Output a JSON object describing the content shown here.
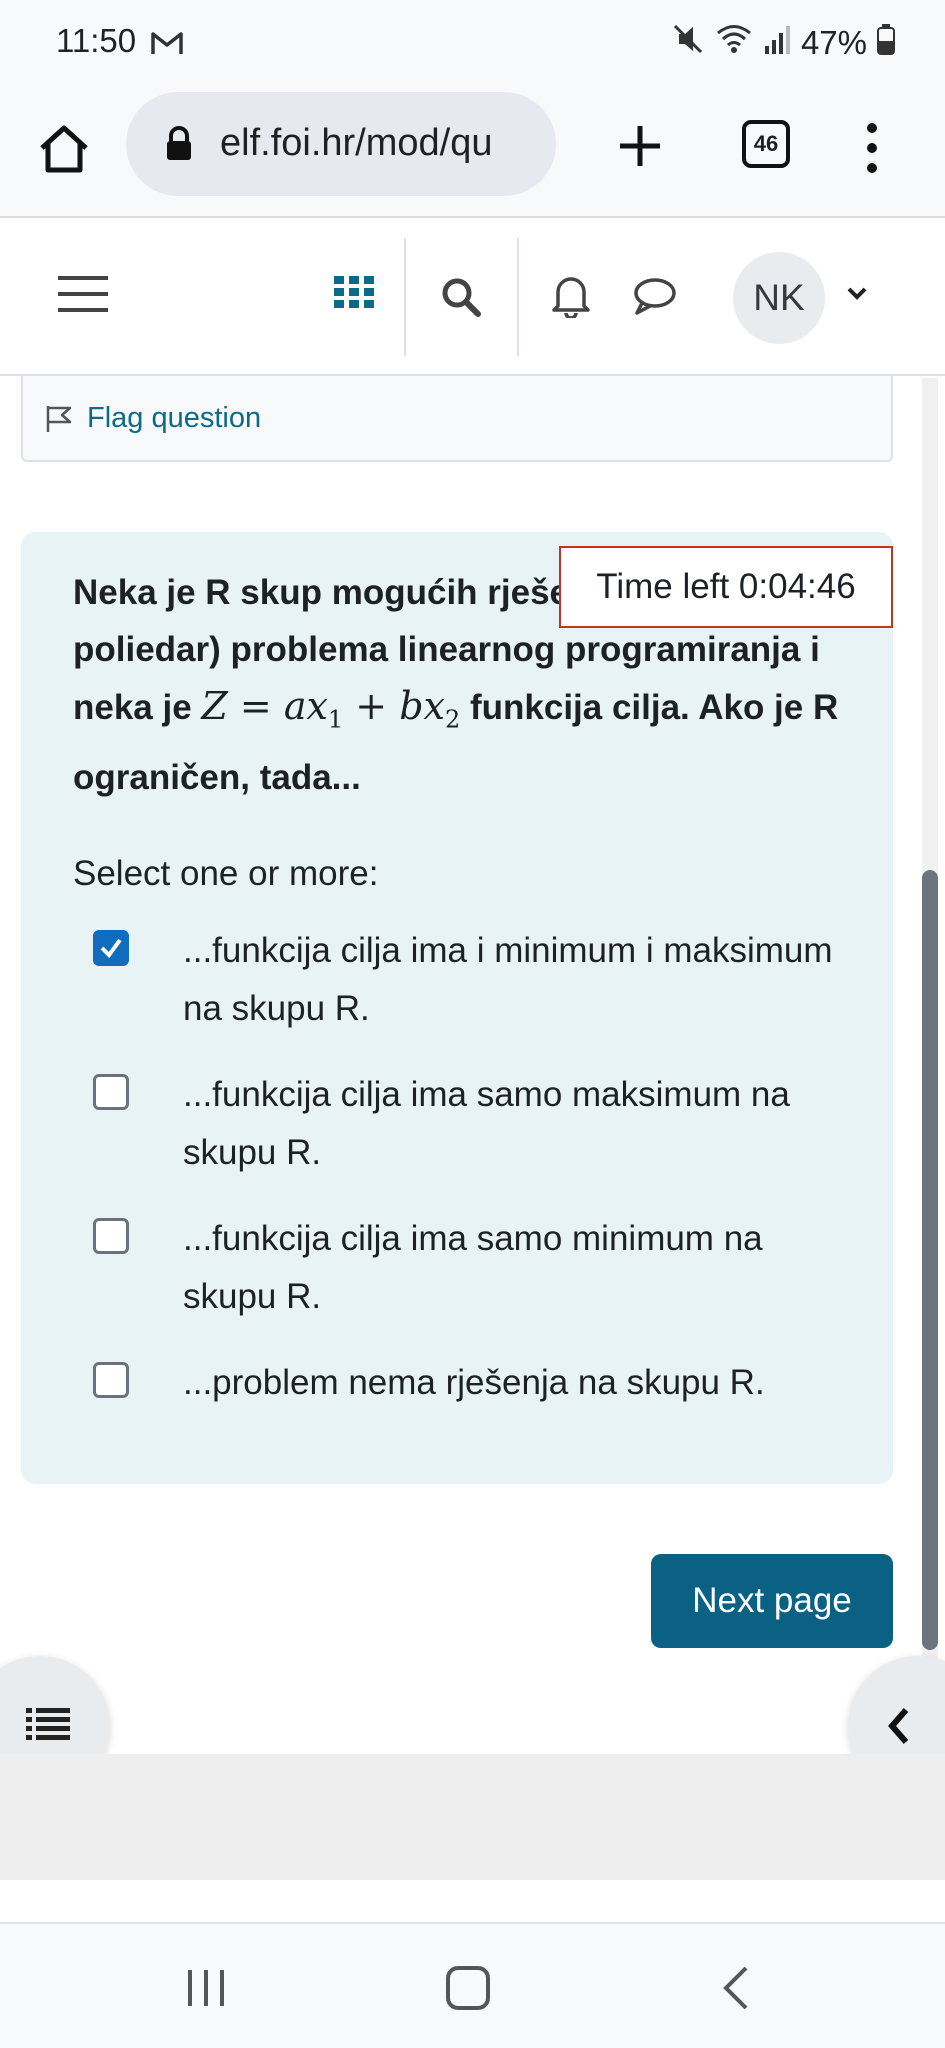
{
  "status_bar": {
    "time": "11:50",
    "battery": "47%"
  },
  "browser": {
    "url": "elf.foi.hr/mod/qu",
    "tab_count": "46"
  },
  "navbar": {
    "avatar_initials": "NK"
  },
  "quiz": {
    "flag_label": "Flag question",
    "timer": "Time left 0:04:46",
    "question_part1": "Neka je R skup mogućih rješenja (konveksni poliedar) problema linearnog programiranja i neka je ",
    "question_math": "Z = ax",
    "question_part2": " funkcija cilja. Ako je R ograničen, tada...",
    "select_label": "Select one or more:",
    "options": [
      {
        "label": "...funkcija cilja ima i minimum i maksimum na skupu R.",
        "checked": true
      },
      {
        "label": "...funkcija cilja ima samo maksimum na skupu R.",
        "checked": false
      },
      {
        "label": "...funkcija cilja ima samo minimum na skupu R.",
        "checked": false
      },
      {
        "label": "...problem nema rješenja na skupu R.",
        "checked": false
      }
    ],
    "next_label": "Next page"
  },
  "colors": {
    "accent": "#0f6cbf",
    "next_button": "#0a6184",
    "question_bg": "#e7f3f5",
    "timer_border": "#ca3120"
  },
  "icons": [
    "home-icon",
    "lock-icon",
    "plus-icon",
    "tabs-icon",
    "more-vert-icon",
    "hamburger-icon",
    "apps-grid-icon",
    "search-icon",
    "bell-icon",
    "chat-icon",
    "chevron-down-icon",
    "flag-icon",
    "list-icon",
    "chevron-left-icon"
  ]
}
